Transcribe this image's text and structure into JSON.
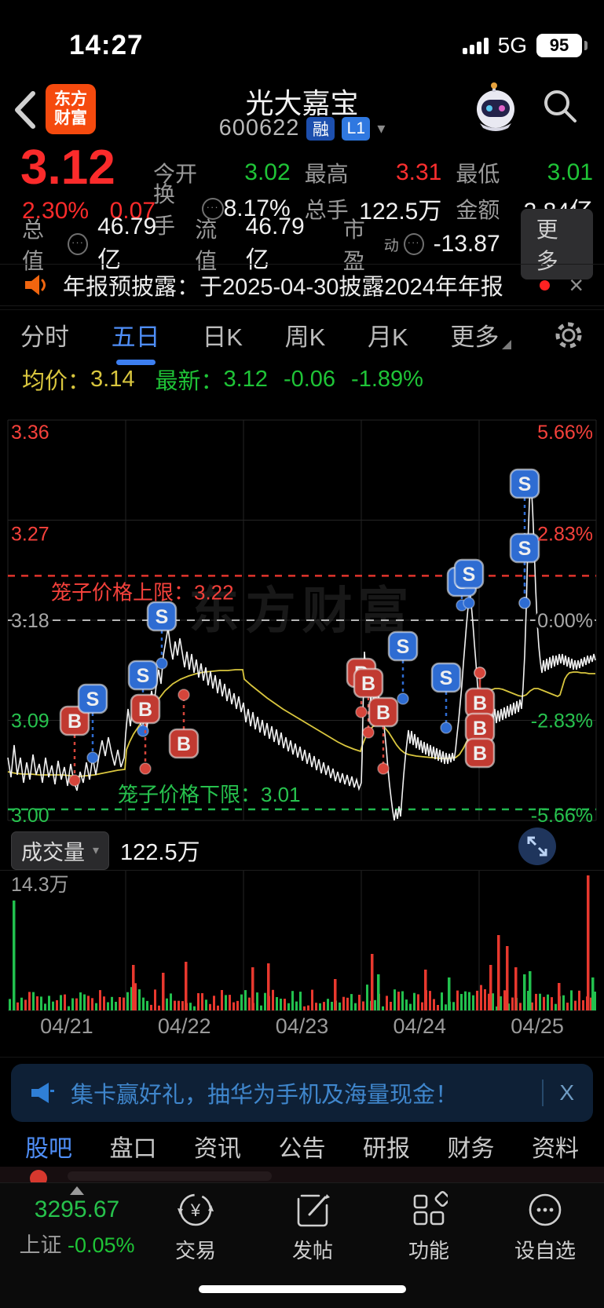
{
  "colors": {
    "red": "#fb2f2f",
    "green": "#1fc437",
    "yellow": "#d9c63e",
    "blue": "#4f8ef7",
    "badge_s": "#2e6cd2",
    "badge_b": "#c13a31",
    "vol_red": "#e8382e",
    "vol_green": "#22c14e"
  },
  "glyphs": {
    "caret": "▾",
    "close": "×",
    "yuan": "¥",
    "dots": "•••"
  },
  "status_bar": {
    "time": "14:27",
    "network": "5G",
    "battery": "95"
  },
  "header": {
    "logo_line1": "东方",
    "logo_line2": "财富",
    "title": "光大嘉宝",
    "code": "600622",
    "margin_badge": "融",
    "level_badge": "L1"
  },
  "quote": {
    "price": "3.12",
    "change_pct": "2.30%",
    "change_amt": "0.07",
    "stats": [
      {
        "label": "今开",
        "value": "3.02"
      },
      {
        "label": "最高",
        "value": "3.31"
      },
      {
        "label": "最低",
        "value": "3.01"
      },
      {
        "label": "换手",
        "value": "8.17%"
      },
      {
        "label": "总手",
        "value": "122.5万"
      },
      {
        "label": "金额",
        "value": "3.84亿"
      }
    ],
    "row3": {
      "l1": "总值",
      "v1": "46.79亿",
      "l2": "流值",
      "v2": "46.79亿",
      "l3": "市盈",
      "l3sup": "动",
      "v3": "-13.87"
    },
    "more": "更多"
  },
  "news": {
    "text": "年报预披露：于2025-04-30披露2024年年报"
  },
  "period_tabs": {
    "items": [
      "分时",
      "五日",
      "日K",
      "周K",
      "月K",
      "更多"
    ],
    "active": "五日"
  },
  "legend": {
    "avg_label": "均价：",
    "avg": "3.14",
    "latest_label": "最新：",
    "latest": "3.12",
    "chg": "-0.06",
    "pct": "-1.89%"
  },
  "volume_header": {
    "indicator": "成交量",
    "current": "122.5万"
  },
  "banner": {
    "text": "集卡赢好礼，抽华为手机及海量现金！"
  },
  "bottom_tabs": {
    "items": [
      "股吧",
      "盘口",
      "资讯",
      "公告",
      "研报",
      "财务",
      "资料"
    ],
    "active": "股吧"
  },
  "bottom_nav": {
    "index_value": "3295.67",
    "index_name": "上证",
    "index_pct": "-0.05%",
    "items": [
      "交易",
      "发帖",
      "功能",
      "设自选"
    ]
  },
  "chart_data": {
    "type": "line",
    "watermark": "东方财富",
    "y_left": [
      "3.36",
      "3.27",
      "3.18",
      "3.09",
      "3.00"
    ],
    "y_right": [
      "5.66%",
      "2.83%",
      "0.00%",
      "-2.83%",
      "-5.66%"
    ],
    "y_range": [
      3.0,
      3.36
    ],
    "prev_close": 3.18,
    "upper_cage": {
      "label": "笼子价格上限：3.22",
      "price": 3.22
    },
    "lower_cage": {
      "label": "笼子价格下限：3.01",
      "price": 3.01
    },
    "x_dates": [
      "04/21",
      "04/22",
      "04/23",
      "04/24",
      "04/25"
    ],
    "series": [
      {
        "name": "price",
        "color": "#f2f2f2"
      },
      {
        "name": "avg",
        "color": "#d9c63e"
      }
    ],
    "price_points": [
      0,
      430,
      4,
      455,
      8,
      414,
      12,
      452,
      16,
      430,
      20,
      462,
      24,
      436,
      28,
      458,
      32,
      426,
      36,
      452,
      40,
      438,
      44,
      462,
      48,
      430,
      52,
      455,
      56,
      440,
      60,
      464,
      64,
      434,
      68,
      458,
      72,
      442,
      76,
      466,
      80,
      438,
      84,
      460,
      88,
      472,
      92,
      448,
      96,
      462,
      100,
      436,
      104,
      458,
      108,
      430,
      112,
      452,
      116,
      428,
      120,
      408,
      124,
      428,
      128,
      404,
      132,
      424,
      136,
      440,
      140,
      420,
      144,
      442,
      148,
      430,
      150,
      400,
      153,
      368,
      156,
      390,
      159,
      362,
      162,
      384,
      165,
      358,
      168,
      380,
      171,
      396,
      174,
      372,
      177,
      394,
      180,
      366,
      183,
      345,
      186,
      362,
      189,
      338,
      192,
      318,
      195,
      336,
      198,
      300,
      201,
      282,
      204,
      265,
      207,
      288,
      210,
      305,
      213,
      282,
      216,
      300,
      219,
      278,
      222,
      296,
      225,
      315,
      228,
      295,
      231,
      318,
      234,
      298,
      237,
      322,
      240,
      305,
      243,
      328,
      246,
      310,
      249,
      332,
      252,
      315,
      255,
      338,
      258,
      320,
      261,
      342,
      264,
      325,
      267,
      348,
      270,
      330,
      273,
      352,
      276,
      336,
      279,
      358,
      282,
      342,
      285,
      362,
      288,
      348,
      291,
      368,
      294,
      352,
      297,
      372,
      300,
      360,
      303,
      385,
      306,
      368,
      309,
      390,
      312,
      372,
      315,
      394,
      318,
      378,
      321,
      398,
      324,
      382,
      327,
      402,
      330,
      386,
      333,
      406,
      336,
      390,
      339,
      410,
      342,
      394,
      345,
      414,
      348,
      398,
      351,
      418,
      354,
      404,
      357,
      422,
      360,
      408,
      363,
      426,
      366,
      412,
      369,
      430,
      372,
      416,
      375,
      434,
      378,
      420,
      381,
      438,
      384,
      424,
      387,
      442,
      390,
      428,
      393,
      446,
      396,
      432,
      399,
      450,
      402,
      436,
      405,
      452,
      408,
      440,
      411,
      456,
      414,
      444,
      417,
      460,
      420,
      448,
      423,
      462,
      426,
      450,
      429,
      464,
      432,
      452,
      435,
      466,
      438,
      454,
      441,
      468,
      444,
      458,
      447,
      470,
      450,
      462,
      451,
      430,
      452,
      380,
      453,
      330,
      454,
      295,
      456,
      325,
      458,
      352,
      460,
      330,
      462,
      358,
      464,
      338,
      466,
      362,
      468,
      344,
      470,
      368,
      472,
      350,
      474,
      374,
      476,
      356,
      478,
      380,
      480,
      400,
      482,
      420,
      484,
      445,
      486,
      465,
      488,
      482,
      490,
      498,
      492,
      510,
      494,
      496,
      496,
      508,
      498,
      492,
      500,
      505,
      502,
      478,
      504,
      452,
      506,
      430,
      508,
      412,
      510,
      395,
      512,
      412,
      514,
      396,
      516,
      414,
      518,
      400,
      520,
      418,
      522,
      404,
      524,
      420,
      526,
      408,
      528,
      424,
      530,
      410,
      532,
      426,
      534,
      412,
      536,
      428,
      538,
      414,
      540,
      430,
      542,
      416,
      544,
      432,
      546,
      418,
      548,
      434,
      550,
      420,
      552,
      436,
      554,
      422,
      556,
      438,
      558,
      424,
      560,
      438,
      562,
      425,
      564,
      436,
      566,
      424,
      568,
      434,
      570,
      420,
      572,
      400,
      574,
      382,
      576,
      360,
      578,
      338,
      580,
      310,
      582,
      285,
      584,
      260,
      586,
      238,
      588,
      218,
      590,
      235,
      592,
      258,
      594,
      285,
      596,
      310,
      598,
      338,
      600,
      352,
      602,
      372,
      604,
      356,
      606,
      376,
      608,
      360,
      610,
      380,
      612,
      364,
      614,
      382,
      616,
      366,
      618,
      384,
      620,
      368,
      622,
      386,
      624,
      370,
      626,
      384,
      628,
      368,
      630,
      382,
      632,
      366,
      634,
      380,
      636,
      364,
      638,
      378,
      640,
      362,
      642,
      376,
      644,
      360,
      646,
      374,
      648,
      358,
      650,
      372,
      652,
      356,
      654,
      368,
      656,
      340,
      658,
      300,
      660,
      240,
      662,
      160,
      664,
      105,
      666,
      75,
      668,
      112,
      670,
      160,
      672,
      215,
      674,
      258,
      676,
      288,
      678,
      308,
      680,
      322,
      682,
      306,
      684,
      320,
      686,
      304,
      688,
      318,
      690,
      302,
      692,
      316,
      694,
      300,
      696,
      314,
      698,
      300,
      700,
      312,
      702,
      298,
      704,
      310,
      706,
      298,
      708,
      312,
      710,
      300,
      712,
      314,
      714,
      302,
      716,
      316,
      718,
      304,
      720,
      318,
      722,
      306,
      724,
      318,
      726,
      306,
      728,
      316,
      730,
      304,
      732,
      314,
      734,
      302,
      736,
      312,
      738,
      300,
      740,
      310,
      742,
      300,
      744,
      308,
      746,
      298,
      748,
      306
    ],
    "avg_points": [
      0,
      448,
      10,
      450,
      20,
      451,
      30,
      451,
      40,
      452,
      50,
      452,
      60,
      452,
      70,
      452,
      80,
      453,
      90,
      454,
      100,
      453,
      110,
      452,
      120,
      450,
      130,
      448,
      140,
      446,
      149,
      445,
      151,
      420,
      155,
      410,
      160,
      400,
      170,
      385,
      180,
      372,
      190,
      358,
      200,
      345,
      210,
      336,
      220,
      330,
      230,
      326,
      240,
      323,
      250,
      321,
      260,
      320,
      270,
      319,
      280,
      319,
      290,
      318,
      299,
      318,
      301,
      330,
      310,
      338,
      320,
      346,
      330,
      354,
      340,
      361,
      350,
      368,
      360,
      374,
      370,
      380,
      380,
      386,
      390,
      392,
      400,
      398,
      410,
      404,
      420,
      410,
      430,
      415,
      440,
      419,
      449,
      422,
      451,
      415,
      455,
      405,
      460,
      396,
      465,
      390,
      470,
      388,
      475,
      388,
      480,
      392,
      485,
      398,
      490,
      406,
      495,
      414,
      500,
      420,
      505,
      424,
      510,
      426,
      520,
      428,
      530,
      429,
      540,
      430,
      550,
      431,
      560,
      431,
      570,
      430,
      575,
      426,
      580,
      418,
      585,
      408,
      590,
      396,
      595,
      384,
      599,
      376,
      601,
      370,
      605,
      360,
      610,
      350,
      615,
      344,
      620,
      342,
      625,
      342,
      630,
      343,
      635,
      345,
      640,
      347,
      645,
      349,
      650,
      351,
      655,
      352,
      660,
      350,
      665,
      345,
      670,
      342,
      675,
      342,
      680,
      344,
      685,
      346,
      690,
      348,
      695,
      350,
      700,
      352,
      703,
      350,
      706,
      340,
      709,
      330,
      712,
      325,
      715,
      322,
      720,
      321,
      725,
      321,
      730,
      322,
      735,
      322,
      740,
      323,
      745,
      323,
      748,
      323
    ],
    "markers": [
      [
        "B",
        85,
        383,
        459
      ],
      [
        "S",
        108,
        355,
        430
      ],
      [
        "S",
        172,
        325,
        396
      ],
      [
        "B",
        175,
        368,
        444
      ],
      [
        "S",
        196,
        250,
        310
      ],
      [
        "B",
        224,
        412,
        350
      ],
      [
        "B",
        450,
        322,
        372
      ],
      [
        "B",
        459,
        335,
        398
      ],
      [
        "B",
        478,
        372,
        444
      ],
      [
        "S",
        503,
        288,
        355
      ],
      [
        "S",
        558,
        328,
        392
      ],
      [
        "S",
        578,
        206,
        236
      ],
      [
        "S",
        587,
        196,
        233
      ],
      [
        "B",
        601,
        360,
        322
      ],
      [
        "B",
        601,
        392,
        322
      ],
      [
        "B",
        601,
        424,
        322
      ],
      [
        "S",
        658,
        81,
        233
      ],
      [
        "S",
        658,
        163,
        233
      ]
    ],
    "volume": {
      "max_label": "14.3万",
      "seed": 97531,
      "spikes": [
        [
          6,
          140,
          "g"
        ],
        [
          158,
          58,
          "r"
        ],
        [
          196,
          48,
          "r"
        ],
        [
          225,
          62,
          "r"
        ],
        [
          310,
          55,
          "r"
        ],
        [
          330,
          60,
          "r"
        ],
        [
          415,
          40,
          "r"
        ],
        [
          462,
          72,
          "r"
        ],
        [
          470,
          46,
          "g"
        ],
        [
          530,
          52,
          "r"
        ],
        [
          560,
          42,
          "g"
        ],
        [
          613,
          58,
          "r"
        ],
        [
          623,
          96,
          "r"
        ],
        [
          634,
          82,
          "r"
        ],
        [
          645,
          55,
          "r"
        ],
        [
          656,
          46,
          "g"
        ],
        [
          663,
          50,
          "g"
        ],
        [
          700,
          35,
          "r"
        ],
        [
          737,
          172,
          "r"
        ],
        [
          743,
          42,
          "g"
        ]
      ]
    }
  }
}
